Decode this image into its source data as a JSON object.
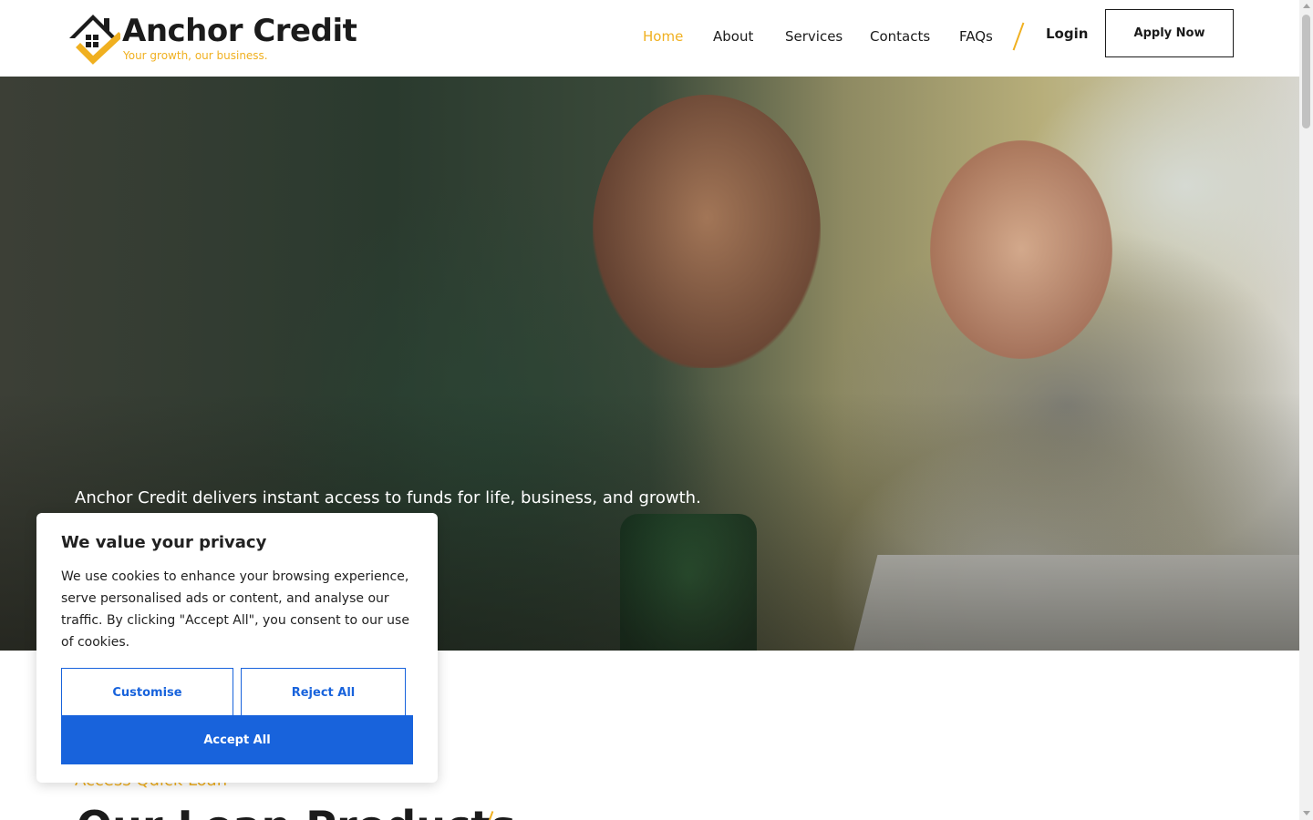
{
  "brand": {
    "name": "Anchor Credit",
    "tagline": "Your growth, our business.",
    "accent_color": "#f0b020",
    "text_color": "#1b1b1b"
  },
  "nav": {
    "items": [
      {
        "label": "Home",
        "active": true
      },
      {
        "label": "About",
        "active": false
      },
      {
        "label": "Services",
        "active": false
      },
      {
        "label": "Contacts",
        "active": false
      },
      {
        "label": "FAQs",
        "active": false
      }
    ],
    "login_label": "Login",
    "apply_label": "Apply Now"
  },
  "hero": {
    "tagline": "Anchor Credit delivers instant access to funds for life, business, and growth."
  },
  "section": {
    "eyebrow": "Access Quick Loan",
    "title": "Our Loan Products"
  },
  "cookie_banner": {
    "title": "We value your privacy",
    "body": "We use cookies to enhance your browsing experience, serve personalised ads or content, and analyse our traffic. By clicking \"Accept All\", you consent to our use of cookies.",
    "customise_label": "Customise",
    "reject_label": "Reject All",
    "accept_label": "Accept All",
    "button_color": "#1863dc"
  },
  "icons": {
    "logo": "house-check-logo-icon",
    "scroll_up": "arrow-up-icon",
    "scroll_down": "arrow-down-icon"
  }
}
